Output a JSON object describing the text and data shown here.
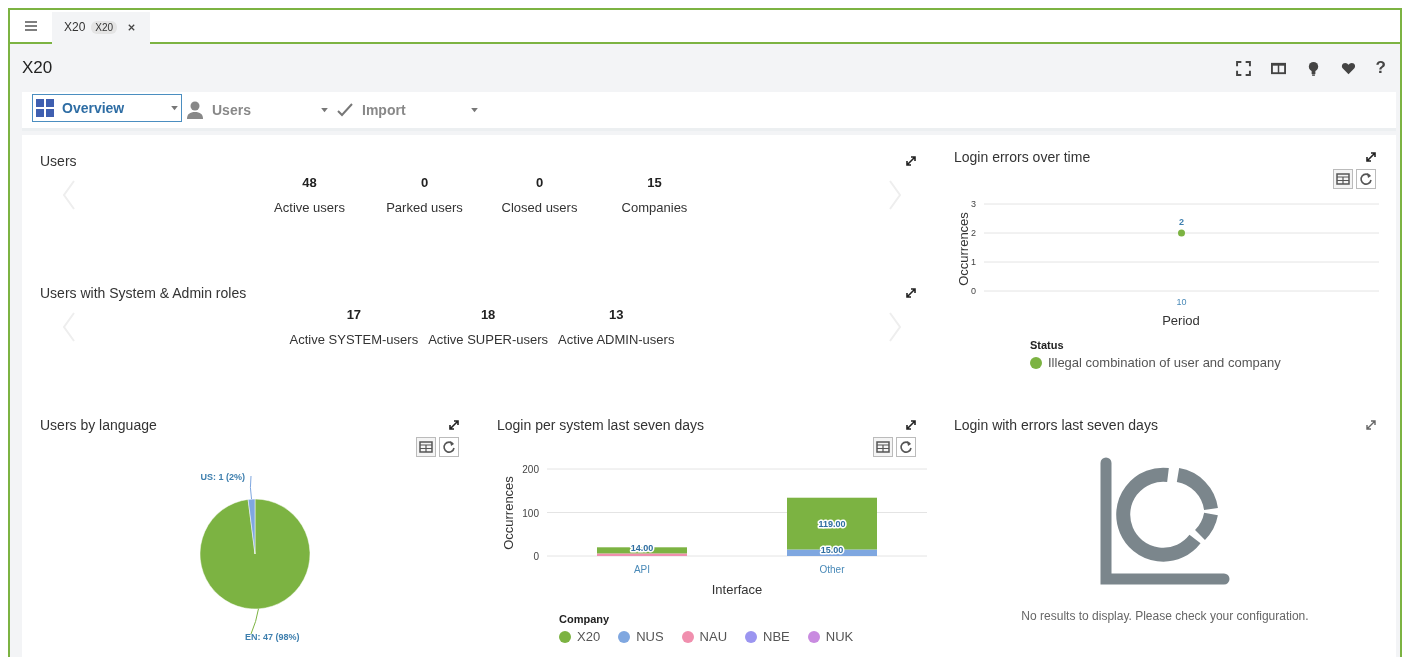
{
  "tab_bar": {
    "tabs": [
      {
        "label": "X20",
        "badge": "X20",
        "selected": true
      }
    ]
  },
  "header": {
    "title": "X20",
    "help": "?"
  },
  "nav": [
    {
      "label": "Overview",
      "selected": true
    },
    {
      "label": "Users",
      "selected": false
    },
    {
      "label": "Import",
      "selected": false
    }
  ],
  "stat_panels": [
    {
      "title": "Users",
      "stats": [
        {
          "value": "48",
          "label": "Active users"
        },
        {
          "value": "0",
          "label": "Parked users"
        },
        {
          "value": "0",
          "label": "Closed users"
        },
        {
          "value": "15",
          "label": "Companies"
        }
      ]
    },
    {
      "title": "Users with System & Admin roles",
      "stats": [
        {
          "value": "17",
          "label": "Active SYSTEM-users"
        },
        {
          "value": "18",
          "label": "Active SUPER-users"
        },
        {
          "value": "13",
          "label": "Active ADMIN-users"
        }
      ]
    }
  ],
  "login_errors_chart": {
    "title": "Login errors over time",
    "legend_title": "Status",
    "chart_data": {
      "type": "line",
      "xlabel": "Period",
      "ylabel": "Occurrences",
      "x": [
        "10"
      ],
      "ylim": [
        0,
        3
      ],
      "yticks": [
        {
          "value": 0,
          "label": "0"
        },
        {
          "value": 1,
          "label": "1"
        },
        {
          "value": 2,
          "label": "2"
        },
        {
          "value": 3,
          "label": "3"
        }
      ],
      "data_labels": true,
      "series": [
        {
          "name": "Illegal combination of user and company",
          "color": "#7cb342",
          "marker": true,
          "values": [
            2
          ]
        }
      ]
    }
  },
  "language_chart": {
    "title": "Users by language",
    "chart_data": {
      "type": "pie",
      "categories": [
        "EN: 47 (98%)",
        "US: 1 (2%)"
      ],
      "values": [
        98,
        2
      ],
      "colors": [
        "#7cb342",
        "#7fa7e0"
      ]
    }
  },
  "system_chart": {
    "title": "Login per system last seven days",
    "legend_title": "Company",
    "chart_data": {
      "type": "bar",
      "stacked": true,
      "xlabel": "Interface",
      "ylabel": "Occurrences",
      "categories": [
        "API",
        "Other"
      ],
      "ylim": [
        0,
        200
      ],
      "yticks": [
        {
          "value": 0,
          "label": "0"
        },
        {
          "value": 100,
          "label": "100"
        },
        {
          "value": 200,
          "label": "200"
        }
      ],
      "series": [
        {
          "name": "X20",
          "color": "#7cb342",
          "values": [
            14,
            119
          ]
        },
        {
          "name": "NUS",
          "color": "#7fa7e0",
          "values": [
            null,
            15
          ]
        },
        {
          "name": "NAU",
          "color": "#f08fae",
          "values": [
            6,
            null
          ]
        },
        {
          "name": "NBE",
          "color": "#9b95f0",
          "values": [
            null,
            null
          ]
        },
        {
          "name": "NUK",
          "color": "#c98be0",
          "values": [
            null,
            null
          ]
        }
      ],
      "annotations": [
        {
          "x": "API",
          "y": 20,
          "text": "14.00"
        },
        {
          "x": "Other",
          "y": 134,
          "text": "119.00"
        },
        {
          "x": "Other",
          "y": 15,
          "text": "15.00"
        }
      ]
    }
  },
  "errors_empty": {
    "title": "Login with errors last seven days",
    "message": "No results to display. Please check your configuration."
  }
}
